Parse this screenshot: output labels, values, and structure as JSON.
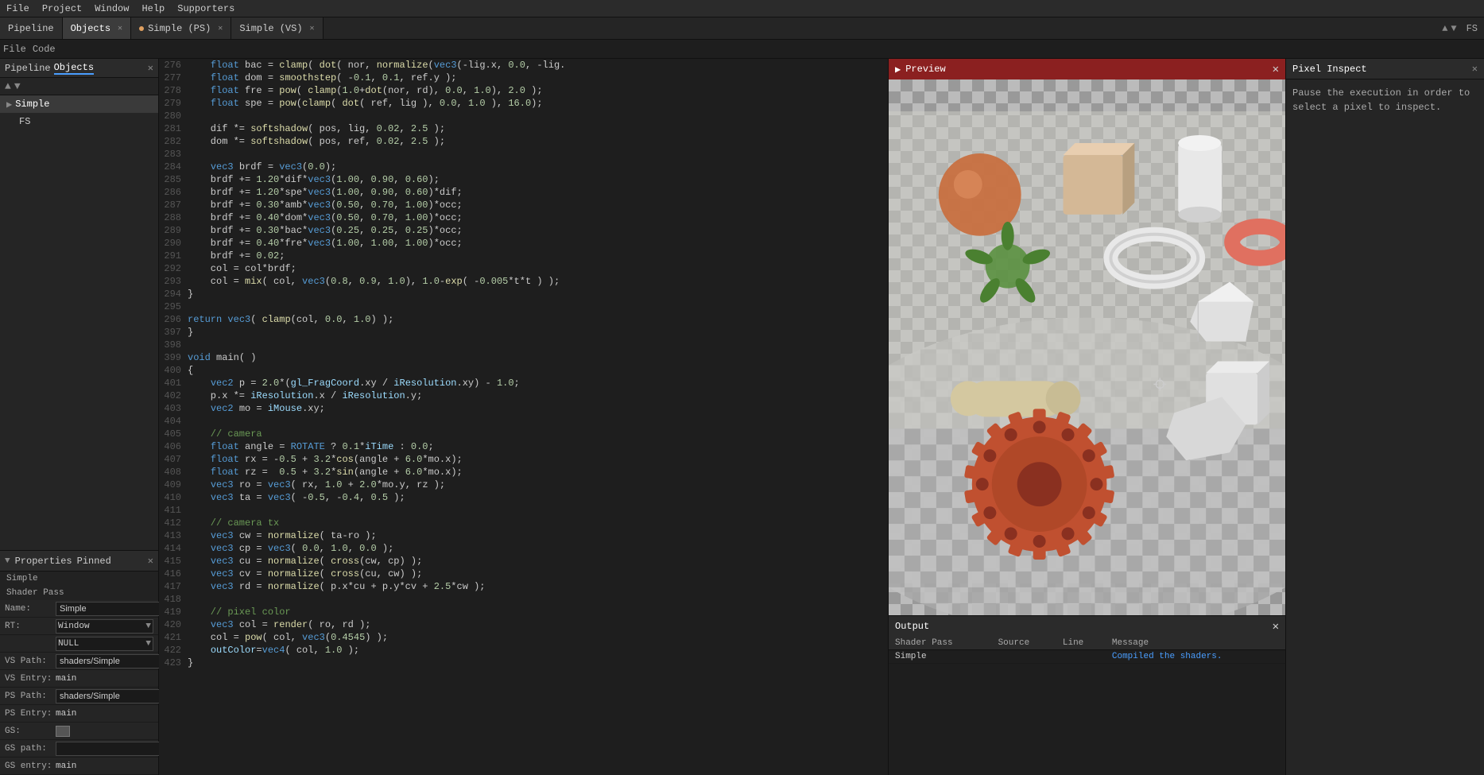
{
  "menu": {
    "items": [
      "File",
      "Project",
      "Window",
      "Help",
      "Supporters"
    ]
  },
  "toolbar": {
    "tabs": [
      {
        "label": "Pipeline",
        "active": false
      },
      {
        "label": "Objects",
        "active": true,
        "closeable": true
      },
      {
        "label": "Simple (PS)",
        "active": false,
        "modified": true,
        "closeable": true
      },
      {
        "label": "Simple (VS)",
        "active": false,
        "closeable": true
      }
    ],
    "nav_arrows": [
      "▲",
      "▼"
    ],
    "fs_label": "FS"
  },
  "file_toolbar": {
    "items": [
      "File",
      "Code"
    ]
  },
  "left_panel": {
    "title_tabs": [
      {
        "label": "Pipeline",
        "active": false
      },
      {
        "label": "Objects",
        "active": true
      }
    ],
    "close_label": "✕",
    "items": [
      {
        "label": "Simple",
        "selected": true,
        "indent": 0
      },
      {
        "label": "FS",
        "selected": false,
        "indent": 1
      }
    ]
  },
  "properties": {
    "header_arrow": "▼",
    "title": "Properties",
    "pinned": "Pinned",
    "close": "✕",
    "section_title": "Simple",
    "subsection": "Shader Pass",
    "rows": [
      {
        "label": "Name:",
        "value": "Simple",
        "has_ok": true
      },
      {
        "label": "RT:",
        "dropdown": "Window",
        "has_dropdown2": true
      },
      {
        "label": "",
        "dropdown2": "NULL"
      },
      {
        "label": "VS Path:",
        "value": "shaders/Simple",
        "has_dots": true
      },
      {
        "label": "VS Entry:",
        "value": "main"
      },
      {
        "label": "PS Path:",
        "value": "shaders/Simple",
        "has_dots": true
      },
      {
        "label": "PS Entry:",
        "value": "main"
      },
      {
        "label": "GS:",
        "has_swatch": true
      },
      {
        "label": "GS path:",
        "value": "",
        "has_dots": true
      },
      {
        "label": "GS entry:",
        "value": "main"
      }
    ]
  },
  "code": {
    "lines": [
      {
        "num": 276,
        "text": "    float bac = clamp( dot( nor, normalize(vec3(-lig.x, 0.0, -lig."
      },
      {
        "num": 277,
        "text": "    float dom = smoothstep( -0.1, 0.1, ref.y );"
      },
      {
        "num": 278,
        "text": "    float fre = pow( clamp(1.0+dot(nor, rd), 0.0, 1.0), 2.0 );"
      },
      {
        "num": 279,
        "text": "    float spe = pow(clamp( dot( ref, lig ), 0.0, 1.0 ), 16.0);"
      },
      {
        "num": 280,
        "text": ""
      },
      {
        "num": 281,
        "text": "    dif *= softshadow( pos, lig, 0.02, 2.5 );"
      },
      {
        "num": 282,
        "text": "    dom *= softshadow( pos, ref, 0.02, 2.5 );"
      },
      {
        "num": 283,
        "text": ""
      },
      {
        "num": 284,
        "text": "    vec3 brdf = vec3(0.0);"
      },
      {
        "num": 285,
        "text": "    brdf += 1.20*dif*vec3(1.00, 0.90, 0.60);"
      },
      {
        "num": 286,
        "text": "    brdf += 1.20*spe*vec3(1.00, 0.90, 0.60)*dif;"
      },
      {
        "num": 287,
        "text": "    brdf += 0.30*amb*vec3(0.50, 0.70, 1.00)*occ;"
      },
      {
        "num": 288,
        "text": "    brdf += 0.40*dom*vec3(0.50, 0.70, 1.00)*occ;"
      },
      {
        "num": 289,
        "text": "    brdf += 0.30*bac*vec3(0.25, 0.25, 0.25)*occ;"
      },
      {
        "num": 290,
        "text": "    brdf += 0.40*fre*vec3(1.00, 1.00, 1.00)*occ;"
      },
      {
        "num": 291,
        "text": "    brdf += 0.02;"
      },
      {
        "num": 292,
        "text": "    col = col*brdf;"
      },
      {
        "num": 293,
        "text": "    col = mix( col, vec3(0.8, 0.9, 1.0), 1.0-exp( -0.005*t*t ) );"
      },
      {
        "num": 294,
        "text": "}"
      },
      {
        "num": 295,
        "text": ""
      },
      {
        "num": 296,
        "text": "return vec3( clamp(col, 0.0, 1.0) );"
      },
      {
        "num": 397,
        "text": "}"
      },
      {
        "num": 398,
        "text": ""
      },
      {
        "num": 399,
        "text": "void main( )"
      },
      {
        "num": 400,
        "text": "{"
      },
      {
        "num": 401,
        "text": "    vec2 p = 2.0*(gl_FragCoord.xy / iResolution.xy) - 1.0;"
      },
      {
        "num": 402,
        "text": "    p.x *= iResolution.x / iResolution.y;"
      },
      {
        "num": 403,
        "text": "    vec2 mo = iMouse.xy;"
      },
      {
        "num": 404,
        "text": ""
      },
      {
        "num": 405,
        "text": "    // camera"
      },
      {
        "num": 406,
        "text": "    float angle = ROTATE ? 0.1*iTime : 0.0;"
      },
      {
        "num": 407,
        "text": "    float rx = -0.5 + 3.2*cos(angle + 6.0*mo.x);"
      },
      {
        "num": 408,
        "text": "    float rz =  0.5 + 3.2*sin(angle + 6.0*mo.x);"
      },
      {
        "num": 409,
        "text": "    vec3 ro = vec3( rx, 1.0 + 2.0*mo.y, rz );"
      },
      {
        "num": 410,
        "text": "    vec3 ta = vec3( -0.5, -0.4, 0.5 );"
      },
      {
        "num": 411,
        "text": ""
      },
      {
        "num": 412,
        "text": "    // camera tx"
      },
      {
        "num": 413,
        "text": "    vec3 cw = normalize( ta-ro );"
      },
      {
        "num": 414,
        "text": "    vec3 cp = vec3( 0.0, 1.0, 0.0 );"
      },
      {
        "num": 415,
        "text": "    vec3 cu = normalize( cross(cw, cp) );"
      },
      {
        "num": 416,
        "text": "    vec3 cv = normalize( cross(cu, cw) );"
      },
      {
        "num": 417,
        "text": "    vec3 rd = normalize( p.x*cu + p.y*cv + 2.5*cw );"
      },
      {
        "num": 418,
        "text": ""
      },
      {
        "num": 419,
        "text": "    // pixel color"
      },
      {
        "num": 420,
        "text": "    vec3 col = render( ro, rd );"
      },
      {
        "num": 421,
        "text": "    col = pow( col, vec3(0.4545) );"
      },
      {
        "num": 422,
        "text": "    outColor=vec4( col, 1.0 );"
      },
      {
        "num": 423,
        "text": "}"
      }
    ]
  },
  "preview": {
    "title": "Preview",
    "close": "✕",
    "pixel_inspect": {
      "title": "Pixel Inspect",
      "close": "✕",
      "message": "Pause the execution in order to select a pixel to inspect."
    }
  },
  "output": {
    "title": "Output",
    "close": "✕",
    "columns": [
      "Shader Pass",
      "Source",
      "Line",
      "Message"
    ],
    "rows": [
      {
        "shader_pass": "Simple",
        "source": "",
        "line": "",
        "message": "Compiled the shaders."
      }
    ]
  }
}
